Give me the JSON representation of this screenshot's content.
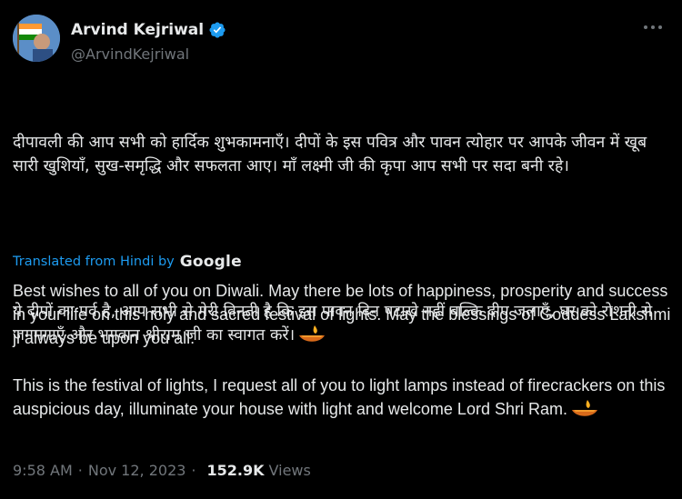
{
  "author": {
    "display_name": "Arvind Kejriwal",
    "handle": "@ArvindKejriwal",
    "verified": true
  },
  "tweet": {
    "hindi_para_1": "दीपावली की आप सभी को हार्दिक शुभकामनाएँ। दीपों के इस पवित्र और पावन त्योहार पर आपके जीवन में खूब सारी खुशियाँ, सुख-समृद्धि और सफलता आए। माँ लक्ष्मी जी की कृपा आप सभी पर सदा बनी रहे।",
    "hindi_para_2": "ये दीपों का पर्व है, आप सभी से मेरी विनती है कि इस पावन दिन पटाखे नहीं बल्कि दीए जलाएँ, घर को रोशनी से जगमगाएँ और भगवान श्रीराम जी का स्वागत करें।"
  },
  "translation": {
    "label": "Translated from Hindi by",
    "provider": "Google",
    "para_1": "Best wishes to all of you on Diwali. May there be lots of happiness, prosperity and success in your life on this holy and sacred festival of lights. May the blessings of Goddess Lakshmi ji always be upon you all.",
    "para_2": "This is the festival of lights, I request all of you to light lamps instead of firecrackers on this auspicious day, illuminate your house with light and welcome Lord Shri Ram."
  },
  "meta": {
    "time": "9:58 AM",
    "separator": "·",
    "date": "Nov 12, 2023",
    "views_count": "152.9K",
    "views_label": "Views"
  },
  "colors": {
    "background": "#000000",
    "text": "#e7e9ea",
    "secondary": "#71767b",
    "link": "#1d9bf0",
    "verified": "#1d9bf0"
  },
  "icons": {
    "verified": "verified-badge-icon",
    "more": "more-options-icon",
    "diya": "diya-emoji"
  }
}
